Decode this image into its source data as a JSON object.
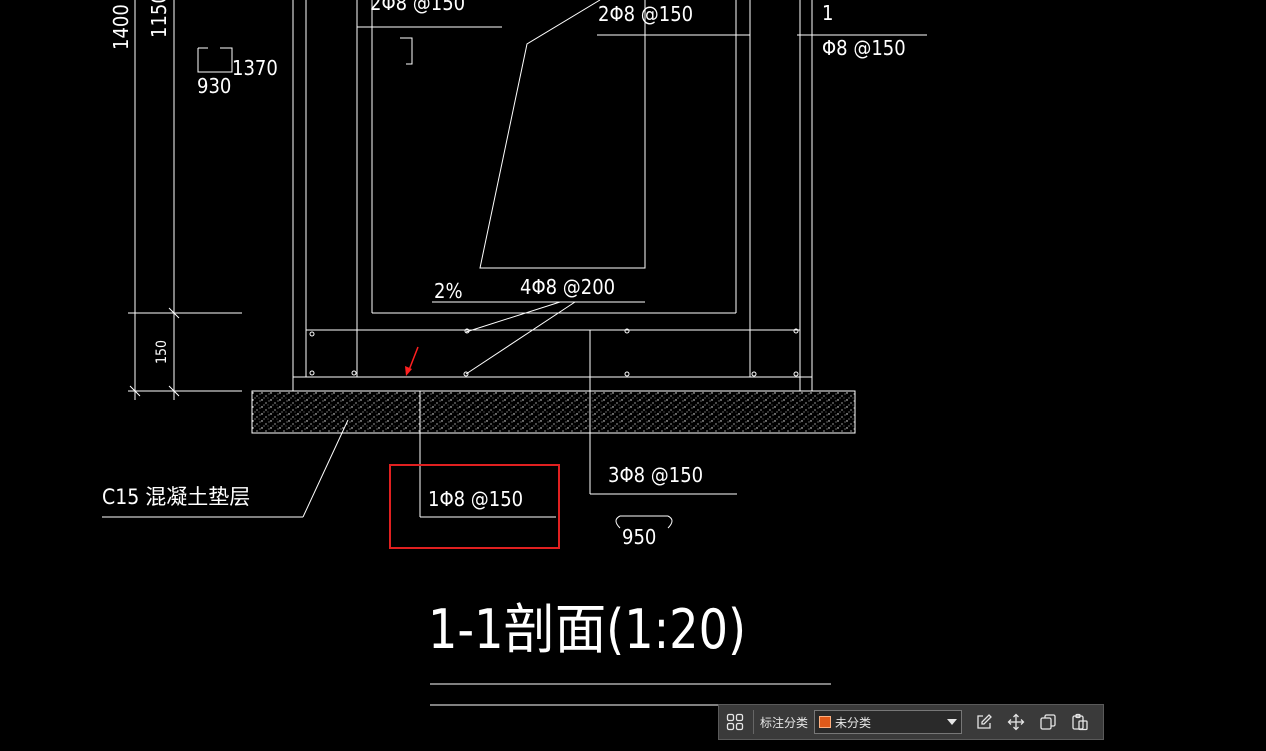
{
  "drawing": {
    "dim_1400": "1400",
    "dim_1150": "1150",
    "dim_150": "150",
    "bend_930": "930",
    "bend_1370": "1370",
    "bend_950": "950",
    "rebar_2_top_left": "2Φ8 @150",
    "rebar_2_top": "2Φ8 @150",
    "rebar_1_marker": "1",
    "rebar_1_top": "Φ8 @150",
    "slope": "2%",
    "rebar_4": "4Φ8 @200",
    "rebar_3": "3Φ8 @150",
    "rebar_1_bottom": "1Φ8 @150",
    "cushion_label": "C15 混凝土垫层",
    "section_title": "1-1剖面(1:20)"
  },
  "toolbar": {
    "label": "标注分类",
    "category_value": "未分类",
    "swatch_color": "#e05a1a"
  }
}
